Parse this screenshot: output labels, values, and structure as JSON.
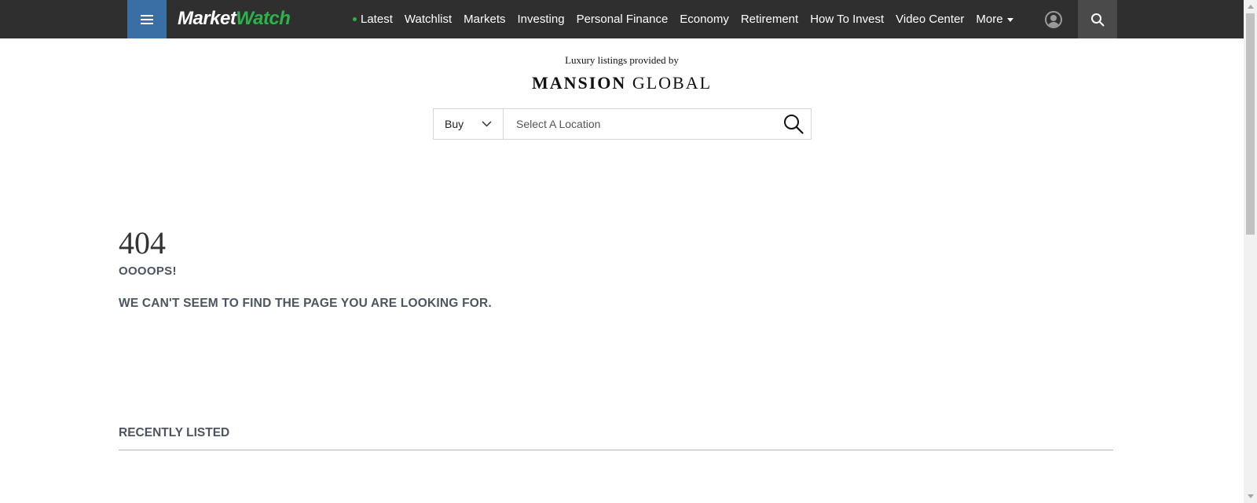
{
  "header": {
    "logo": {
      "part1": "Market",
      "part2": "Watch"
    },
    "nav": [
      {
        "label": "Latest",
        "live": true
      },
      {
        "label": "Watchlist"
      },
      {
        "label": "Markets"
      },
      {
        "label": "Investing"
      },
      {
        "label": "Personal Finance"
      },
      {
        "label": "Economy"
      },
      {
        "label": "Retirement"
      },
      {
        "label": "How To Invest"
      },
      {
        "label": "Video Center"
      },
      {
        "label": "More",
        "dropdown": true
      }
    ],
    "icons": {
      "menu": "hamburger-icon",
      "user": "user-icon",
      "search": "search-icon"
    },
    "colors": {
      "bar": "#2f2f2f",
      "menu": "#3a6fa6",
      "brand_green": "#2bb34a",
      "search_bg": "#4a4a4a"
    }
  },
  "mansion": {
    "provided_by": "Luxury listings provided by",
    "logo": {
      "part1": "MANSION",
      "part2": "GLOBAL"
    },
    "type_select": "Buy",
    "location_placeholder": "Select A Location"
  },
  "error": {
    "code": "404",
    "title": "OOOOPS!",
    "message": "WE CAN'T SEEM TO FIND THE PAGE YOU ARE LOOKING FOR."
  },
  "recent": {
    "title": "RECENTLY LISTED"
  }
}
